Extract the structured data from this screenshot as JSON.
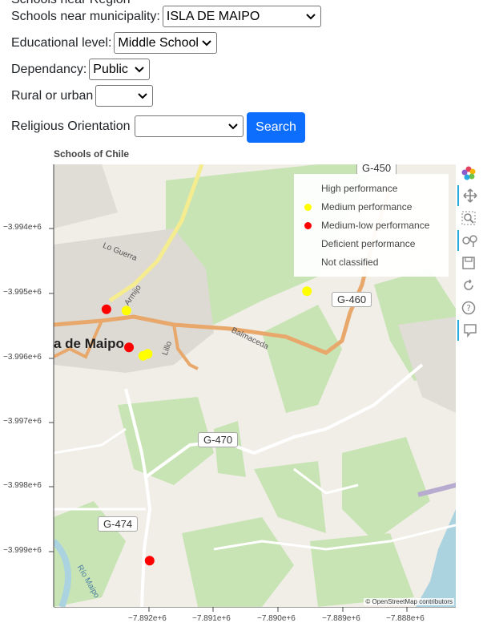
{
  "form": {
    "cut_label": "Schools near Region",
    "municipality": {
      "label": "Schools near municipality:",
      "value": "ISLA DE MAIPO"
    },
    "level": {
      "label": "Educational level:",
      "value": "Middle School"
    },
    "dependency": {
      "label": "Dependancy:",
      "value": "Public"
    },
    "rural": {
      "label": "Rural or urban",
      "value": ""
    },
    "religious": {
      "label": "Religious Orientation",
      "value": ""
    },
    "search_label": "Search"
  },
  "plot": {
    "title": "Schools of Chile",
    "attribution": "© OpenStreetMap contributors",
    "y_ticks": [
      "−3.994e+6",
      "−3.995e+6",
      "−3.996e+6",
      "−3.997e+6",
      "−3.998e+6",
      "−3.999e+6"
    ],
    "x_ticks": [
      "−7.892e+6",
      "−7.891e+6",
      "−7.890e+6",
      "−7.889e+6",
      "−7.888e+6"
    ],
    "legend": [
      {
        "label": "High performance",
        "color": "#00a651"
      },
      {
        "label": "Medium performance",
        "color": "#ffff00"
      },
      {
        "label": "Medium-low performance",
        "color": "#ff0000"
      },
      {
        "label": "Deficient performance",
        "color": "#8b0000"
      },
      {
        "label": "Not classified",
        "color": "#808080"
      }
    ],
    "map_labels": {
      "road_g450": "G-450",
      "road_g460": "G-460",
      "road_g470": "G-470",
      "road_g474": "G-474",
      "town": "a de Maipo",
      "lo_guerra": "Lo Guerra",
      "armijo": "Armijo",
      "balmaceda": "Balmaceda",
      "lillo": "Lillo",
      "rio_maipo": "Río Maipo"
    },
    "schools": [
      {
        "x": -7892.66,
        "y": -3995.25,
        "color": "#ff0000"
      },
      {
        "x": -7892.35,
        "y": -3995.27,
        "color": "#ffff00"
      },
      {
        "x": -7892.31,
        "y": -3995.84,
        "color": "#ff0000"
      },
      {
        "x": -7892.09,
        "y": -3995.97,
        "color": "#ffff00"
      },
      {
        "x": -7892.02,
        "y": -3995.94,
        "color": "#ffff00"
      },
      {
        "x": -7889.55,
        "y": -3994.97,
        "color": "#ffff00"
      },
      {
        "x": -7891.99,
        "y": -3999.14,
        "color": "#ff0000"
      }
    ]
  }
}
